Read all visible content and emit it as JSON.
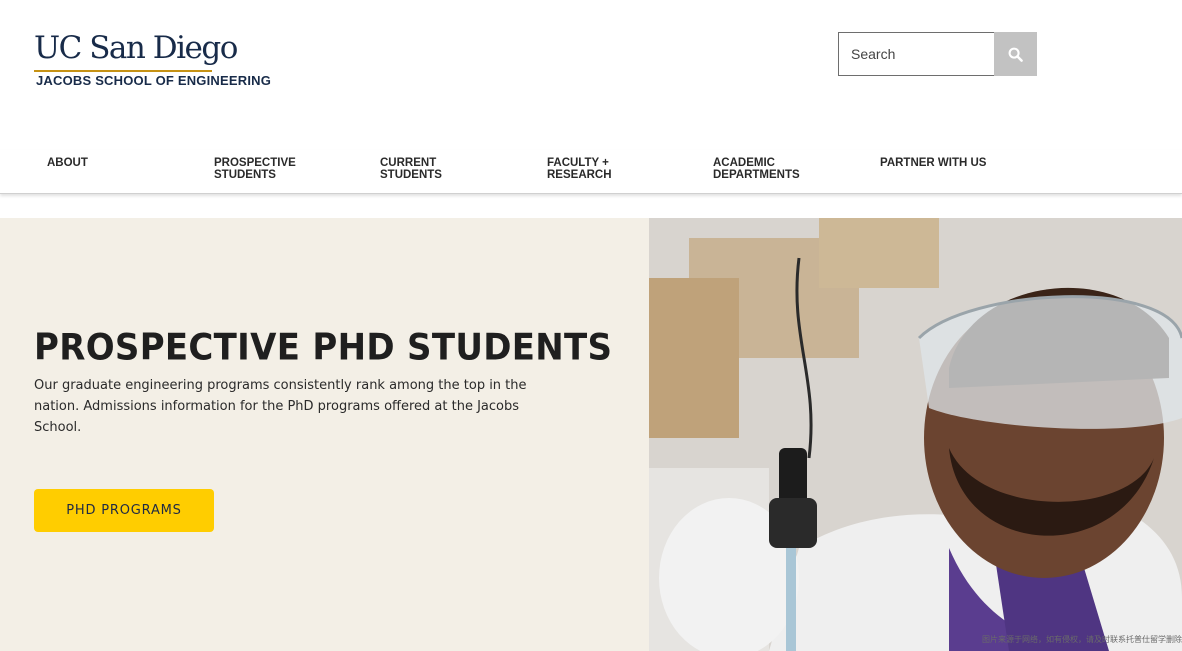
{
  "header": {
    "logo": {
      "wordmark": "UC San Diego",
      "school": "JACOBS SCHOOL OF ENGINEERING"
    },
    "search": {
      "placeholder": "Search",
      "button_icon": "search-icon"
    }
  },
  "nav": {
    "items": [
      {
        "label": "ABOUT"
      },
      {
        "label": "PROSPECTIVE STUDENTS"
      },
      {
        "label": "CURRENT STUDENTS"
      },
      {
        "label": "FACULTY + RESEARCH"
      },
      {
        "label": "ACADEMIC DEPARTMENTS"
      },
      {
        "label": "PARTNER WITH US"
      }
    ]
  },
  "hero": {
    "title": "PROSPECTIVE PHD STUDENTS",
    "description": "Our graduate engineering programs consistently rank among the top in the nation. Admissions information for the PhD programs offered at the Jacobs School.",
    "cta_label": "PHD PROGRAMS",
    "image_watermark": "图片来源于网络，如有侵权，请及时联系托普仕留学删除"
  },
  "colors": {
    "navy": "#182b49",
    "gold": "#c69214",
    "cta_yellow": "#ffcd00",
    "hero_bg": "#f3efe6"
  }
}
